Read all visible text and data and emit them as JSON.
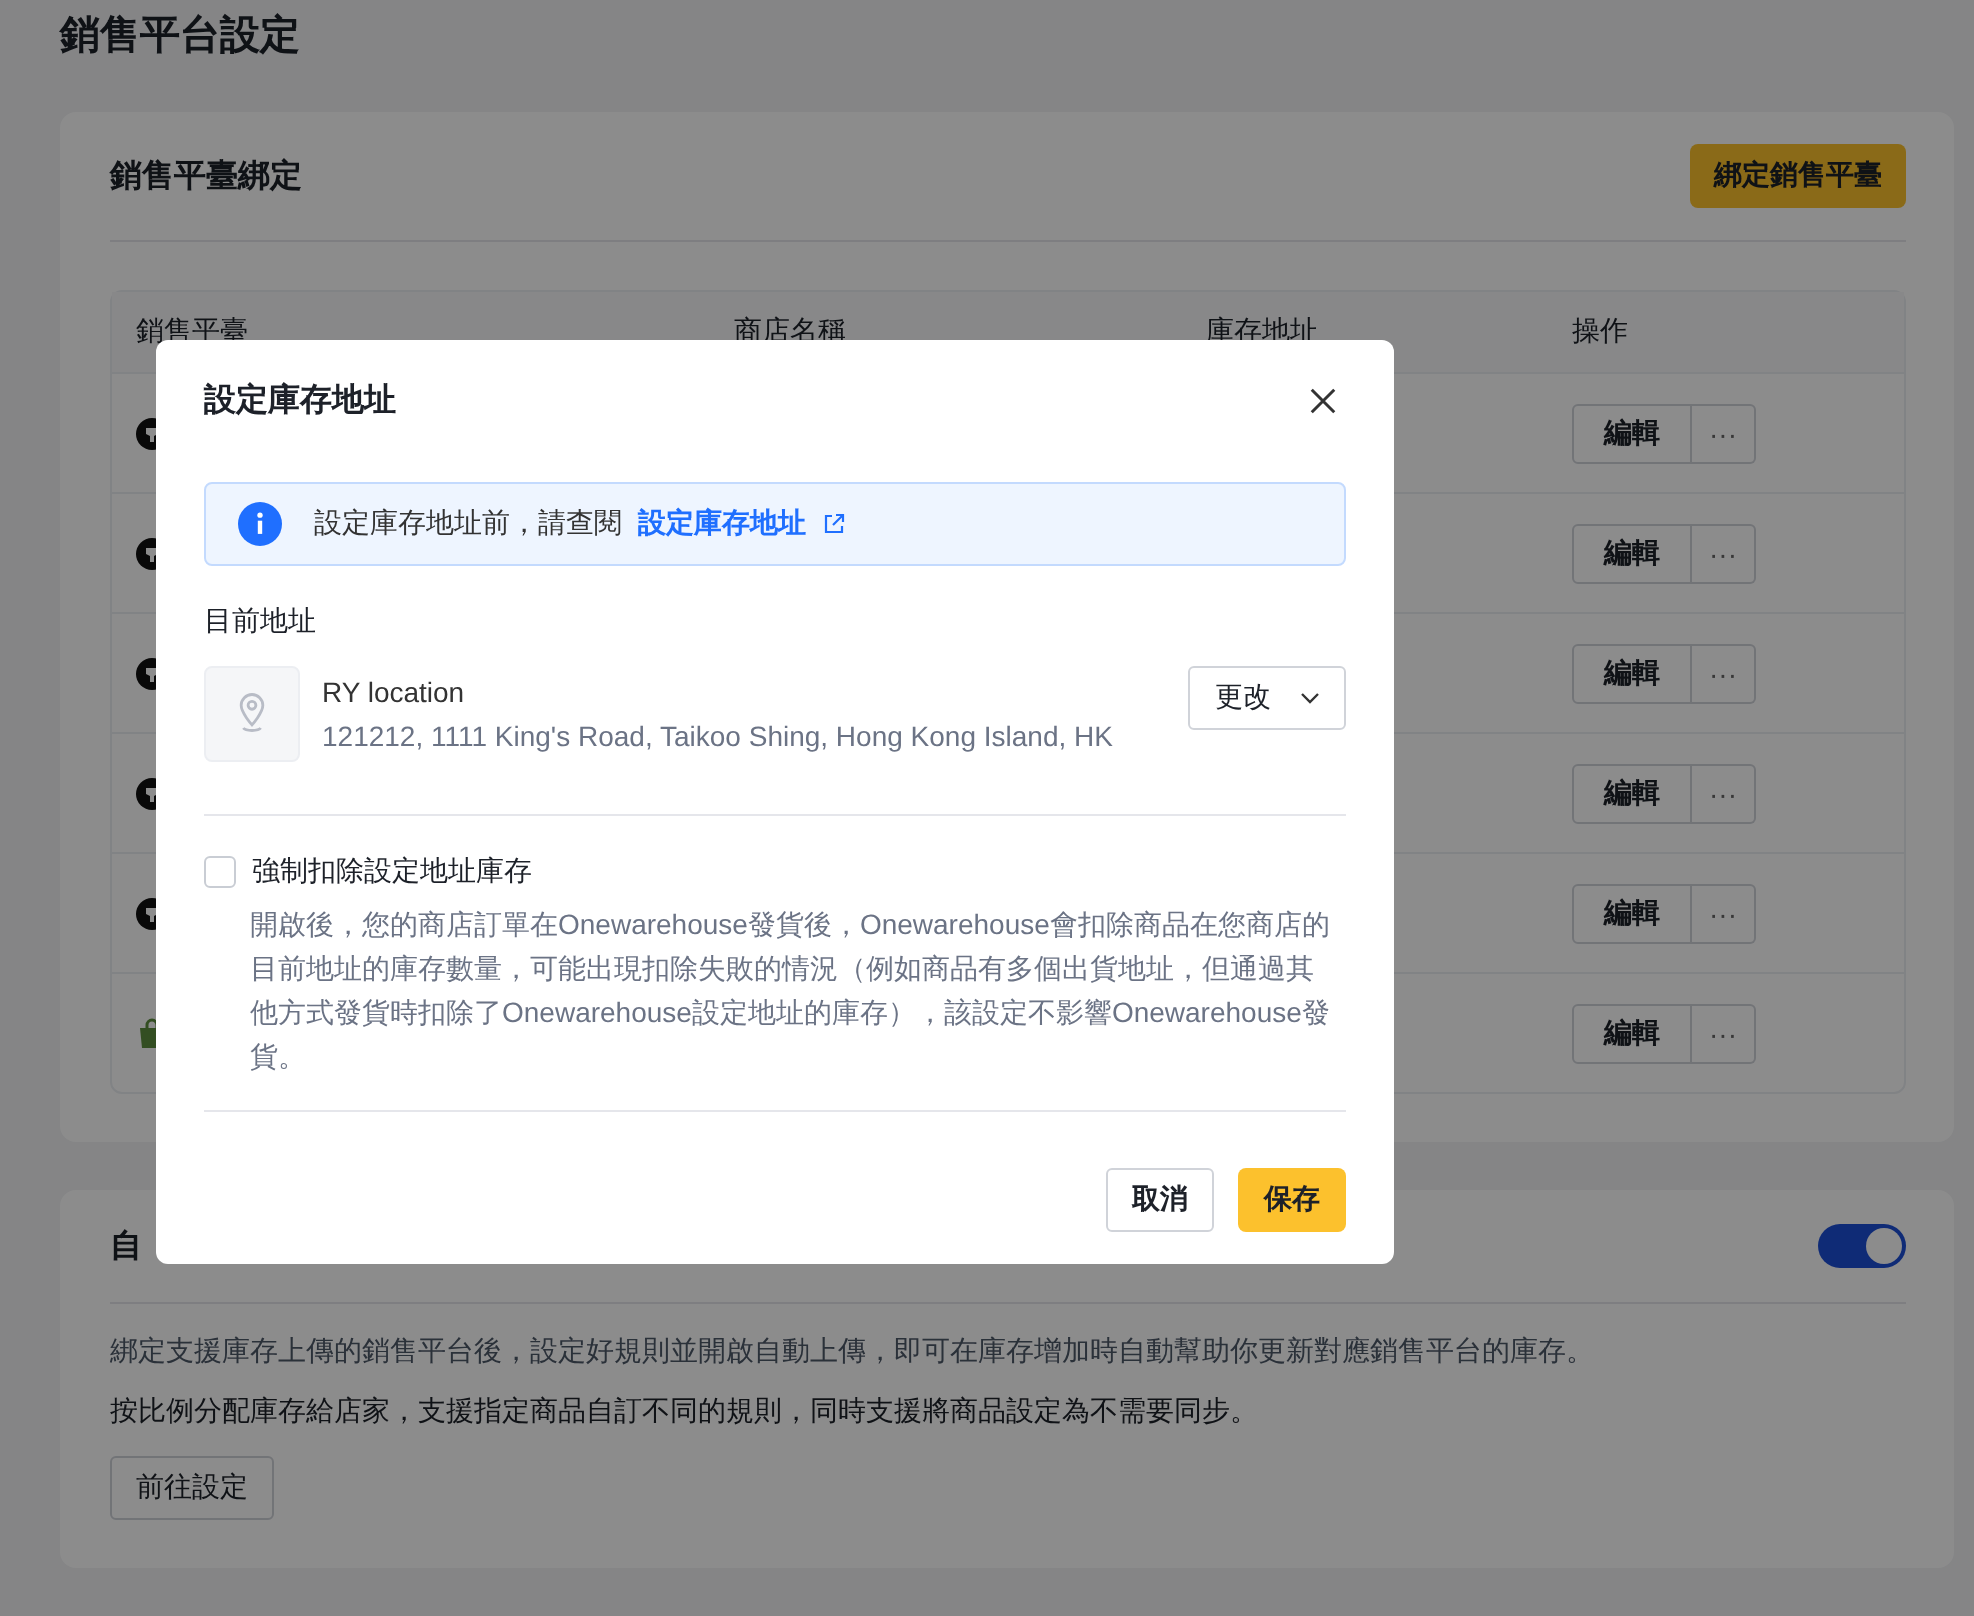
{
  "page": {
    "title": "銷售平台設定"
  },
  "binding_card": {
    "title": "銷售平臺綁定",
    "bind_button": "綁定銷售平臺",
    "table": {
      "columns": [
        "銷售平臺",
        "商店名稱",
        "庫存地址",
        "操作"
      ],
      "rows": [
        {
          "kind": "dark-logo",
          "edit": "編輯",
          "more": "···"
        },
        {
          "kind": "dark-logo",
          "edit": "編輯",
          "more": "···"
        },
        {
          "kind": "dark-logo",
          "edit": "編輯",
          "more": "···"
        },
        {
          "kind": "dark-logo",
          "edit": "編輯",
          "more": "···"
        },
        {
          "kind": "dark-logo",
          "edit": "編輯",
          "more": "···"
        },
        {
          "kind": "bag",
          "edit": "編輯",
          "more": "···"
        }
      ]
    }
  },
  "auto_card": {
    "title": "自",
    "toggle": {
      "on": true
    },
    "paragraphs": [
      "綁定支援庫存上傳的銷售平台後，設定好規則並開啟自動上傳，即可在庫存增加時自動幫助你更新對應銷售平台的庫存。",
      "按比例分配庫存給店家，支援指定商品自訂不同的規則，同時支援將商品設定為不需要同步。"
    ],
    "button": "前往設定"
  },
  "dialog": {
    "title": "設定庫存地址",
    "notice": {
      "text": "設定庫存地址前，請查閱",
      "link": "設定庫存地址"
    },
    "current_label": "目前地址",
    "address": {
      "name": "RY location",
      "line": "121212, 1111 King's Road, Taikoo Shing, Hong Kong Island, HK"
    },
    "change_button": "更改",
    "force_deduct": {
      "label": "強制扣除設定地址庫存",
      "checked": false,
      "description": "開啟後，您的商店訂單在Onewarehouse發貨後，Onewarehouse會扣除商品在您商店的目前地址的庫存數量，可能出現扣除失敗的情況（例如商品有多個出貨地址，但通過其他方式發貨時扣除了Onewarehouse設定地址的庫存），該設定不影響Onewarehouse發貨。"
    },
    "buttons": {
      "cancel": "取消",
      "save": "保存"
    }
  }
}
